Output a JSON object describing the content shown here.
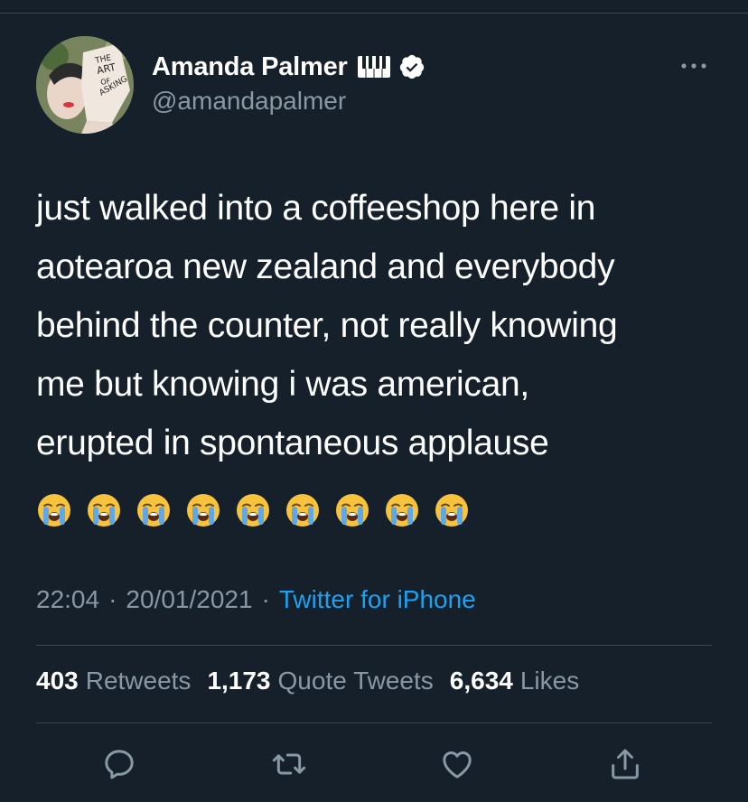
{
  "user": {
    "name": "Amanda Palmer",
    "handle": "@amandapalmer",
    "avatar_text": "THE ART OF ASKING",
    "name_badge_icon": "piano-keyboard-icon",
    "verified_icon": "verified-badge-icon"
  },
  "tweet": {
    "text": "just walked into a coffeeshop here in\naotearoa new zealand and everybody\nbehind the counter, not really knowing\nme but knowing i was american,\nerupted in spontaneous applause",
    "emojis": [
      "😭",
      "😭",
      "😭",
      "😭",
      "😭",
      "😭",
      "😭",
      "😭",
      "😭"
    ],
    "time": "22:04",
    "date": "20/01/2021",
    "separator": "·",
    "source": "Twitter for iPhone"
  },
  "stats": {
    "retweets": {
      "count": "403",
      "label": "Retweets"
    },
    "quote_tweets": {
      "count": "1,173",
      "label": "Quote Tweets"
    },
    "likes": {
      "count": "6,634",
      "label": "Likes"
    }
  },
  "actions": [
    "reply-icon",
    "retweet-icon",
    "like-icon",
    "share-icon"
  ],
  "colors": {
    "background": "#15202b",
    "text": "#ffffff",
    "secondary_text": "#8899a6",
    "link": "#1da1f2",
    "divider": "#38444d",
    "verified": "#ffffff",
    "emoji_face": "#f7c23c",
    "emoji_tears": "#5fa8e8"
  }
}
